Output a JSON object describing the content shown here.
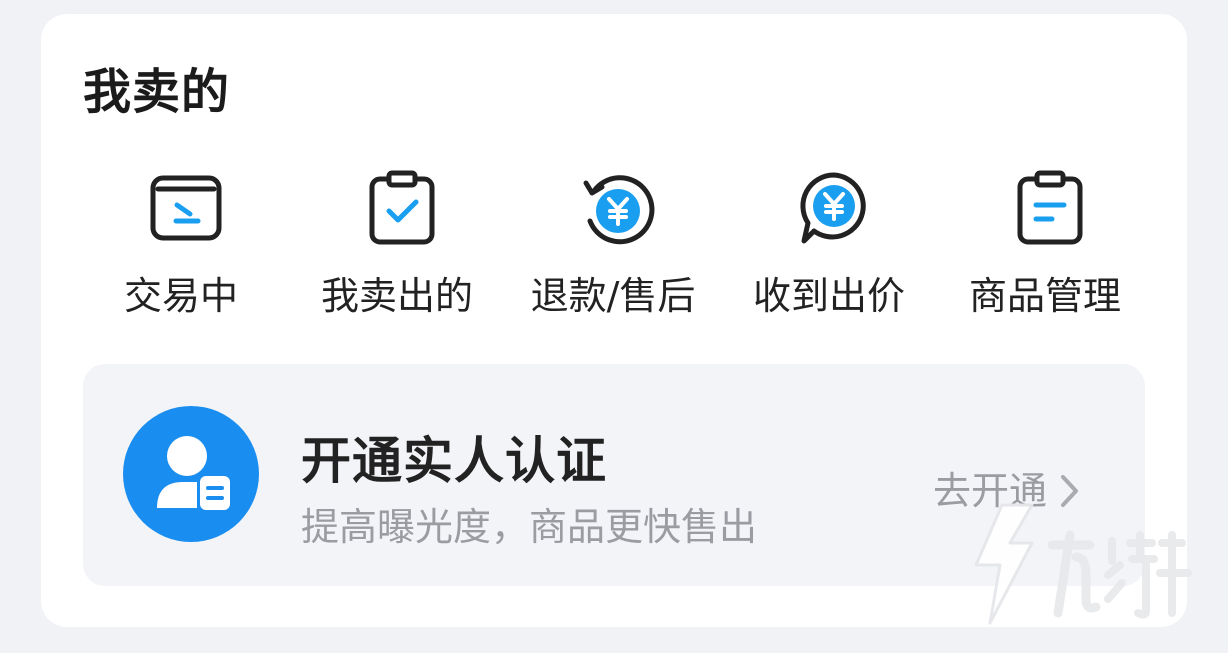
{
  "section": {
    "title": "我卖的"
  },
  "actions": [
    {
      "label": "交易中",
      "icon": "trading-icon"
    },
    {
      "label": "我卖出的",
      "icon": "sold-clipboard-icon"
    },
    {
      "label": "退款/售后",
      "icon": "refund-yuan-icon"
    },
    {
      "label": "收到出价",
      "icon": "offer-yuan-bubble-icon"
    },
    {
      "label": "商品管理",
      "icon": "product-clipboard-icon"
    }
  ],
  "verify_banner": {
    "title": "开通实人认证",
    "subtitle": "提高曝光度，商品更快售出",
    "cta_label": "去开通",
    "icon": "real-name-verify-icon"
  },
  "colors": {
    "accent": "#1a9ef0",
    "avatar_bg": "#1a8ef0",
    "icon_stroke": "#222222",
    "banner_bg": "#f3f4f8",
    "muted_text": "#9a9ca2",
    "page_bg": "#f1f2f5"
  }
}
